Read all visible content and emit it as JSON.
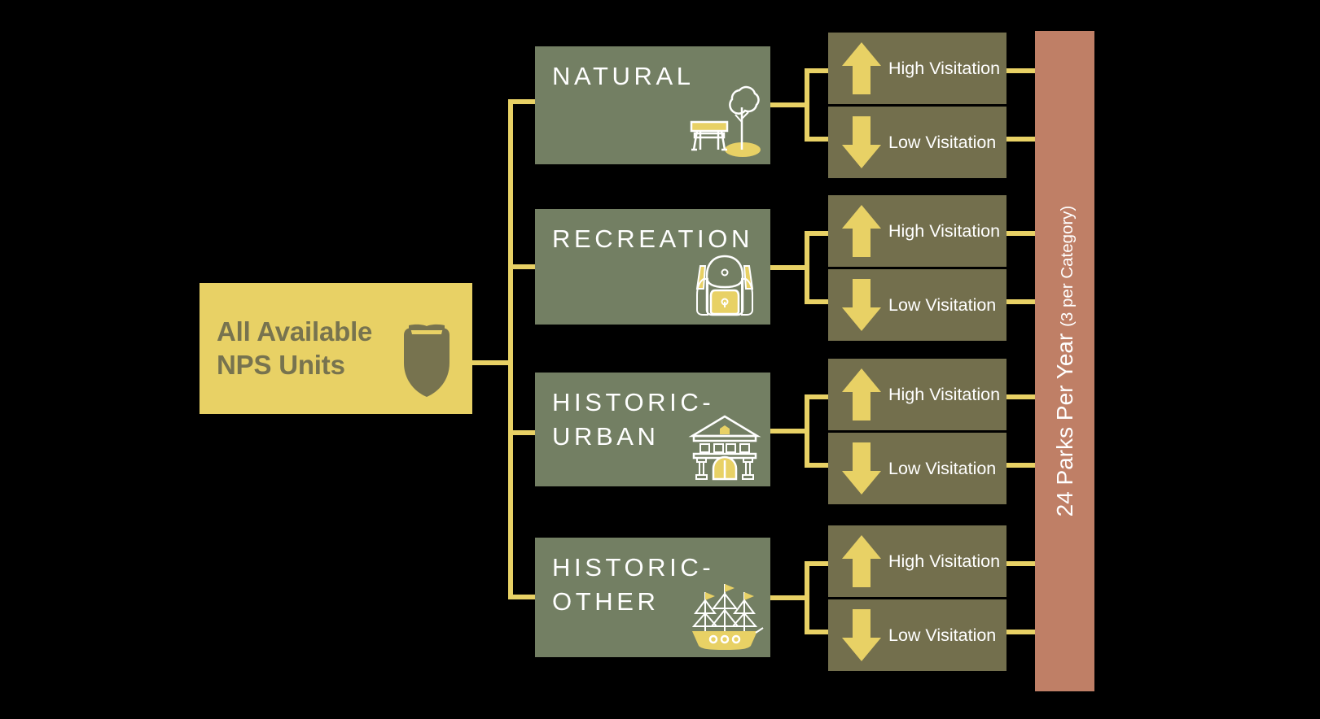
{
  "diagram": {
    "title_hidden": "NPS Park Selection Flow",
    "colors": {
      "yellow": "#E8D165",
      "category_green": "#737F63",
      "visitation_olive": "#736F4D",
      "result_salmon": "#BF7F66",
      "text_white": "#FFFFFF",
      "root_text_olive": "#77734F",
      "background": "#000000"
    },
    "root": {
      "label": "All Available\nNPS Units",
      "icon": "nps-arrowhead-icon"
    },
    "categories": [
      {
        "label": "NATURAL",
        "icon": "tree-and-bench-icon",
        "visitation": [
          {
            "label": "High Visitation",
            "icon": "arrow-up-icon"
          },
          {
            "label": "Low Visitation",
            "icon": "arrow-down-icon"
          }
        ]
      },
      {
        "label": "RECREATION",
        "icon": "backpack-icon",
        "visitation": [
          {
            "label": "High Visitation",
            "icon": "arrow-up-icon"
          },
          {
            "label": "Low Visitation",
            "icon": "arrow-down-icon"
          }
        ]
      },
      {
        "label": "HISTORIC-\nURBAN",
        "icon": "classical-building-icon",
        "visitation": [
          {
            "label": "High Visitation",
            "icon": "arrow-up-icon"
          },
          {
            "label": "Low Visitation",
            "icon": "arrow-down-icon"
          }
        ]
      },
      {
        "label": "HISTORIC-\nOTHER",
        "icon": "sailing-ship-icon",
        "visitation": [
          {
            "label": "High Visitation",
            "icon": "arrow-up-icon"
          },
          {
            "label": "Low Visitation",
            "icon": "arrow-down-icon"
          }
        ]
      }
    ],
    "result": {
      "main": "24 Parks Per Year ",
      "sub": "(3 per Category)"
    }
  }
}
